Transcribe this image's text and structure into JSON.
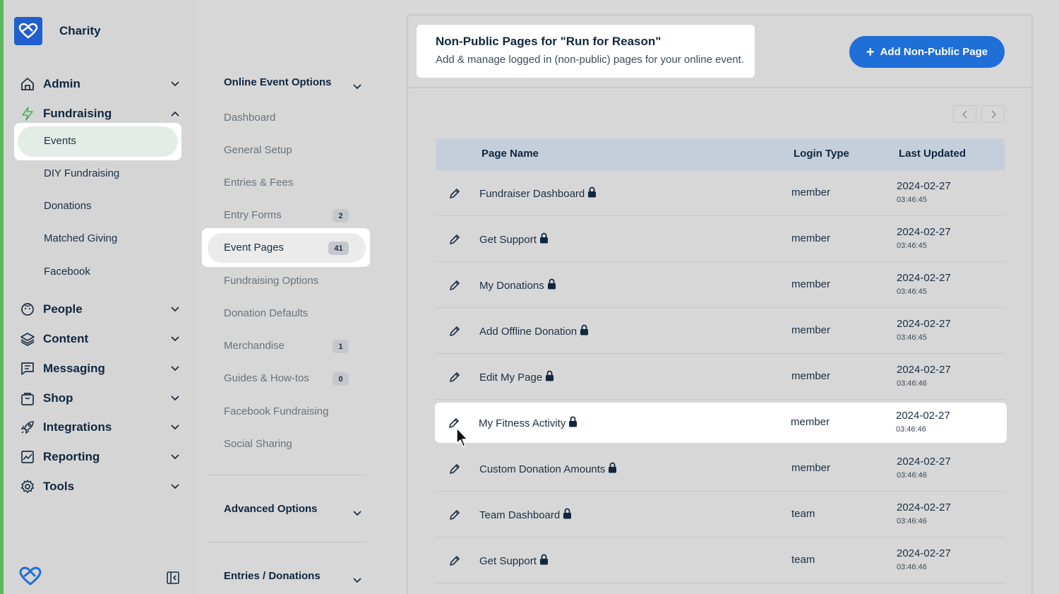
{
  "brand": {
    "name": "Charity"
  },
  "sidebar": {
    "main": [
      {
        "label": "Admin",
        "icon": "home-icon"
      },
      {
        "label": "Fundraising",
        "icon": "bolt-icon"
      },
      {
        "label": "People",
        "icon": "smiley-icon"
      },
      {
        "label": "Content",
        "icon": "layers-icon"
      },
      {
        "label": "Messaging",
        "icon": "message-icon"
      },
      {
        "label": "Shop",
        "icon": "bag-icon"
      },
      {
        "label": "Integrations",
        "icon": "rocket-icon"
      },
      {
        "label": "Reporting",
        "icon": "chart-icon"
      },
      {
        "label": "Tools",
        "icon": "gear-icon"
      }
    ],
    "fundraising_sub": [
      "Events",
      "DIY Fundraising",
      "Donations",
      "Matched Giving",
      "Facebook"
    ],
    "active_sub": "Events"
  },
  "options": {
    "section1": "Online Event Options",
    "items": [
      {
        "label": "Dashboard"
      },
      {
        "label": "General Setup"
      },
      {
        "label": "Entries & Fees"
      },
      {
        "label": "Entry Forms",
        "badge": "2"
      },
      {
        "label": "Event Pages",
        "badge": "41"
      },
      {
        "label": "Fundraising Options"
      },
      {
        "label": "Donation Defaults"
      },
      {
        "label": "Merchandise",
        "badge": "1"
      },
      {
        "label": "Guides & How-tos",
        "badge": "0"
      },
      {
        "label": "Facebook Fundraising"
      },
      {
        "label": "Social Sharing"
      }
    ],
    "active": "Event Pages",
    "section2": "Advanced Options",
    "section3": "Entries / Donations"
  },
  "main": {
    "title": "Non-Public Pages for \"Run for Reason\"",
    "subtitle": "Add & manage logged in (non-public) pages for your online event.",
    "add_button": "Add Non-Public Page",
    "columns": [
      "Page Name",
      "Login Type",
      "Last Updated"
    ],
    "rows": [
      {
        "name": "Fundraiser Dashboard",
        "login": "member",
        "date": "2024-02-27",
        "time": "03:46:45"
      },
      {
        "name": "Get Support",
        "login": "member",
        "date": "2024-02-27",
        "time": "03:46:45"
      },
      {
        "name": "My Donations",
        "login": "member",
        "date": "2024-02-27",
        "time": "03:46:45"
      },
      {
        "name": "Add Offline Donation",
        "login": "member",
        "date": "2024-02-27",
        "time": "03:46:45"
      },
      {
        "name": "Edit My Page",
        "login": "member",
        "date": "2024-02-27",
        "time": "03:46:46"
      },
      {
        "name": "My Fitness Activity",
        "login": "member",
        "date": "2024-02-27",
        "time": "03:46:46"
      },
      {
        "name": "Custom Donation Amounts",
        "login": "member",
        "date": "2024-02-27",
        "time": "03:46:46"
      },
      {
        "name": "Team Dashboard",
        "login": "team",
        "date": "2024-02-27",
        "time": "03:46:46"
      },
      {
        "name": "Get Support",
        "login": "team",
        "date": "2024-02-27",
        "time": "03:46:46"
      }
    ],
    "highlighted_row": 5
  },
  "colors": {
    "accent": "#1f6fd6",
    "brand": "#1f5fd0",
    "edge": "#5cb85c",
    "table_header": "#c5cfdb"
  }
}
